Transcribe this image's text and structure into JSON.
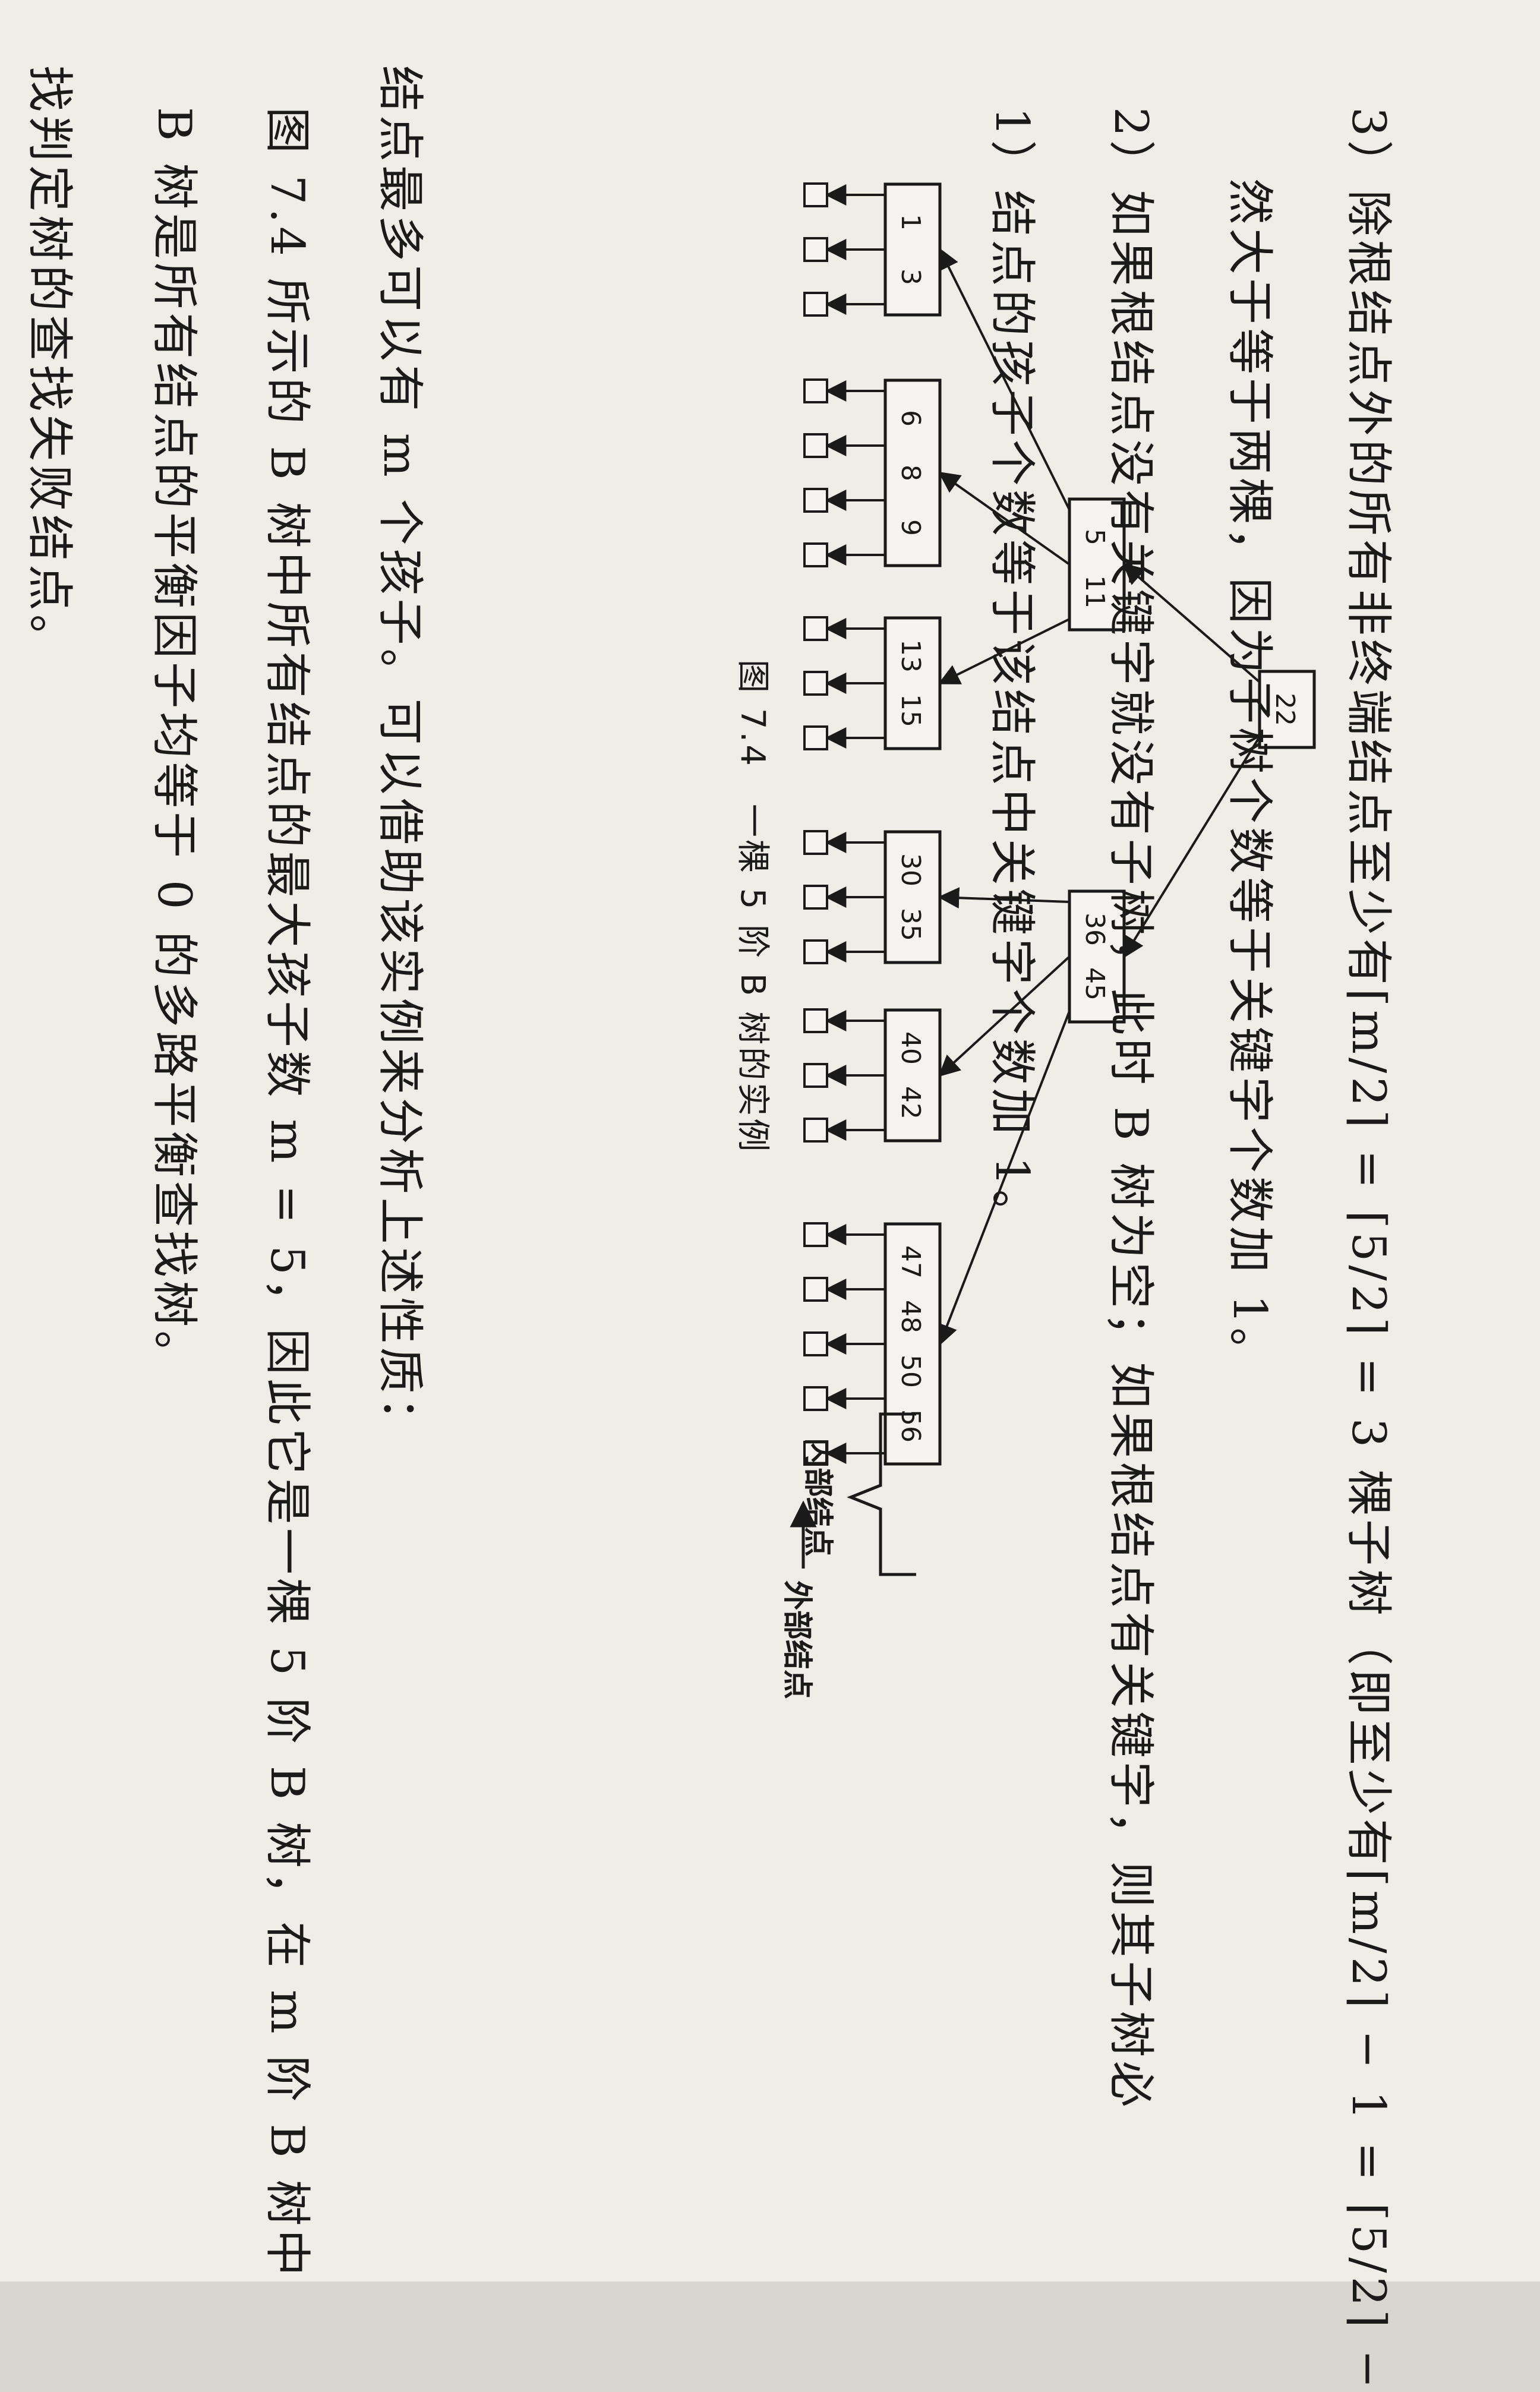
{
  "text": {
    "line1": "找判定树的查找失败结点。",
    "line2": "B 树是所有结点的平衡因子均等于 0 的多路平衡查找树。",
    "line3": "图 7.4 所示的 B 树中所有结点的最大孩子数 m = 5，因此它是一棵 5 阶 B 树，在 m 阶 B 树中",
    "line4": "结点最多可以有 m 个孩子。可以借助该实例来分析上述性质：",
    "item1": "1）结点的孩子个数等于该结点中关键字个数加 1。",
    "item2": "2）如果根结点没有关键字就没有子树，此时 B 树为空；如果根结点有关键字，则其子树必",
    "item2b": "然大于等于两棵，因为子树个数等于关键字个数加 1。",
    "item3": "3）除根结点外的所有非终端结点至少有⌈m/2⌉ = ⌈5/2⌉ = 3 棵子树（即至少有⌈m/2⌉ − 1 = ⌈5/2⌉ −"
  },
  "figure": {
    "caption": "图 7.4　一棵 5 阶 B 树的实例",
    "internal_label": "内部结点",
    "external_label": "外部结点",
    "root": [
      "22"
    ],
    "level1": [
      [
        "5",
        "11"
      ],
      [
        "36",
        "45"
      ]
    ],
    "leaves": [
      [
        "1",
        "3"
      ],
      [
        "6",
        "8",
        "9"
      ],
      [
        "13",
        "15"
      ],
      [
        "30",
        "35"
      ],
      [
        "40",
        "42"
      ],
      [
        "47",
        "48",
        "50",
        "56"
      ]
    ]
  }
}
